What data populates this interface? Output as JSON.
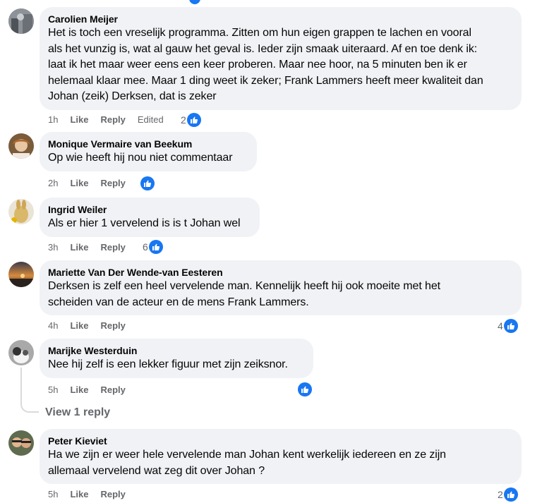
{
  "comments": [
    {
      "author": "Carolien Meijer",
      "text": "Het is toch een vreselijk programma. Zitten om hun eigen grappen te lachen en vooral\nals het vunzig is, wat al gauw het geval is. Ieder zijn smaak uiteraard. Af en toe denk ik:\nlaat ik het maar weer eens een keer proberen. Maar nee hoor, na 5 minuten ben ik er\nhelemaal klaar mee. Maar 1 ding weet ik zeker; Frank Lammers heeft meer kwaliteit dan\nJohan (zeik) Derksen, dat is zeker",
      "time": "1h",
      "like": "Like",
      "reply": "Reply",
      "edited": "Edited",
      "reactions": "2"
    },
    {
      "author": "Monique Vermaire van Beekum",
      "text": "Op wie heeft hij nou niet commentaar",
      "time": "2h",
      "like": "Like",
      "reply": "Reply",
      "reactions": ""
    },
    {
      "author": "Ingrid Weiler",
      "text": "Als er hier 1 vervelend is is t Johan wel",
      "time": "3h",
      "like": "Like",
      "reply": "Reply",
      "reactions": "6"
    },
    {
      "author": "Mariette Van Der Wende-van Eesteren",
      "text": "Derksen is zelf een heel vervelende man. Kennelijk heeft hij ook moeite met het\nscheiden van de acteur en de mens Frank Lammers.",
      "time": "4h",
      "like": "Like",
      "reply": "Reply",
      "reactions": "4"
    },
    {
      "author": "Marijke Westerduin",
      "text": "Nee hij zelf is een lekker figuur met zijn zeiksnor.",
      "time": "5h",
      "like": "Like",
      "reply": "Reply",
      "reactions": ""
    },
    {
      "author": "Peter Kieviet",
      "text": "Ha we zijn er weer hele vervelende man Johan kent werkelijk iedereen en ze zijn\nallemaal vervelend wat zeg dit over Johan ?",
      "time": "5h",
      "like": "Like",
      "reply": "Reply",
      "reactions": "2"
    }
  ],
  "view_reply": "View 1 reply",
  "icons": {
    "like": "thumbs-up-icon"
  },
  "colors": {
    "accent": "#1877f2",
    "bubble": "#f0f2f5",
    "meta": "#65676b"
  }
}
